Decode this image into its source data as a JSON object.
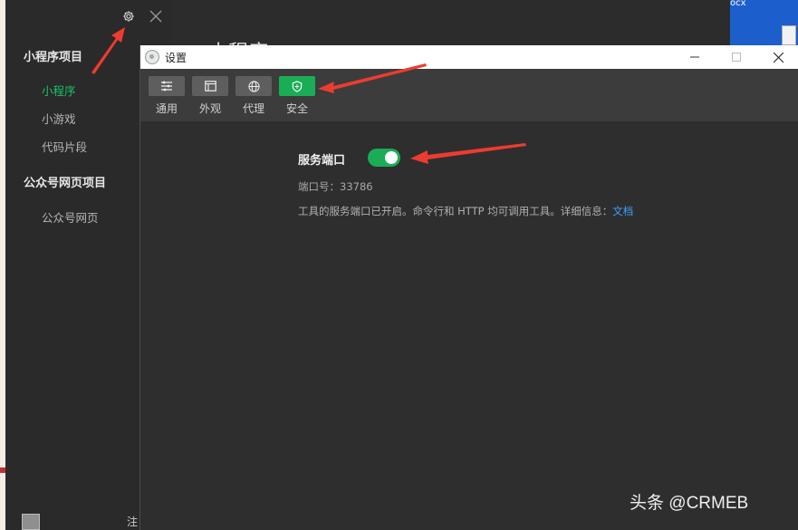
{
  "sidebar": {
    "section_mini": "小程序项目",
    "items_mini": [
      "小程序",
      "小游戏",
      "代码片段"
    ],
    "section_oa": "公众号网页项目",
    "items_oa": [
      "公众号网页"
    ],
    "bottom_text": "注"
  },
  "main": {
    "title_partial": "小程序"
  },
  "desktop": {
    "file_label": "ocx"
  },
  "dialog": {
    "title": "设置",
    "tabs": [
      {
        "label": "通用",
        "icon": "sliders-icon"
      },
      {
        "label": "外观",
        "icon": "window-icon"
      },
      {
        "label": "代理",
        "icon": "globe-icon"
      },
      {
        "label": "安全",
        "icon": "shield-icon"
      }
    ],
    "active_tab": "安全",
    "service_port_label": "服务端口",
    "service_port_enabled": true,
    "port_text": "端口号：33786",
    "description": "工具的服务端口已开启。命令行和 HTTP 均可调用工具。详细信息：",
    "doc_link": "文档"
  },
  "watermark": "头条 @CRMEB",
  "colors": {
    "accent_green": "#1aad56",
    "active_nav": "#19c16b",
    "link_blue": "#3ea0ff",
    "arrow_red": "#ee3b30"
  }
}
